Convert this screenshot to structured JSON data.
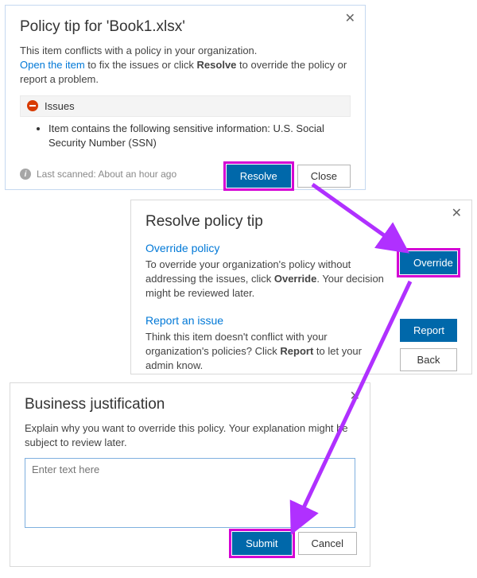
{
  "dialog1": {
    "title": "Policy tip for 'Book1.xlsx'",
    "body_pre": "This item conflicts with a policy in your organization.",
    "link": "Open the item",
    "body_mid": " to fix the issues or click ",
    "body_bold": "Resolve",
    "body_post": " to override the policy or report a problem.",
    "issues_label": "Issues",
    "issue_item": "Item contains the following sensitive information: U.S. Social Security Number (SSN)",
    "scan": "Last scanned: About an hour ago",
    "resolve_btn": "Resolve",
    "close_btn": "Close"
  },
  "dialog2": {
    "title": "Resolve policy tip",
    "override_h": "Override policy",
    "override_pre": "To override your organization's policy without addressing the issues, click ",
    "override_bold": "Override",
    "override_post": ". Your decision might be reviewed later.",
    "override_btn": "Override",
    "report_h": "Report an issue",
    "report_pre": "Think this item doesn't conflict with your organization's policies? Click ",
    "report_bold": "Report",
    "report_post": " to let your admin know.",
    "report_btn": "Report",
    "back_btn": "Back"
  },
  "dialog3": {
    "title": "Business justification",
    "body": "Explain why you want to override this policy. Your explanation might be subject to review later.",
    "placeholder": "Enter text here",
    "submit_btn": "Submit",
    "cancel_btn": "Cancel"
  }
}
